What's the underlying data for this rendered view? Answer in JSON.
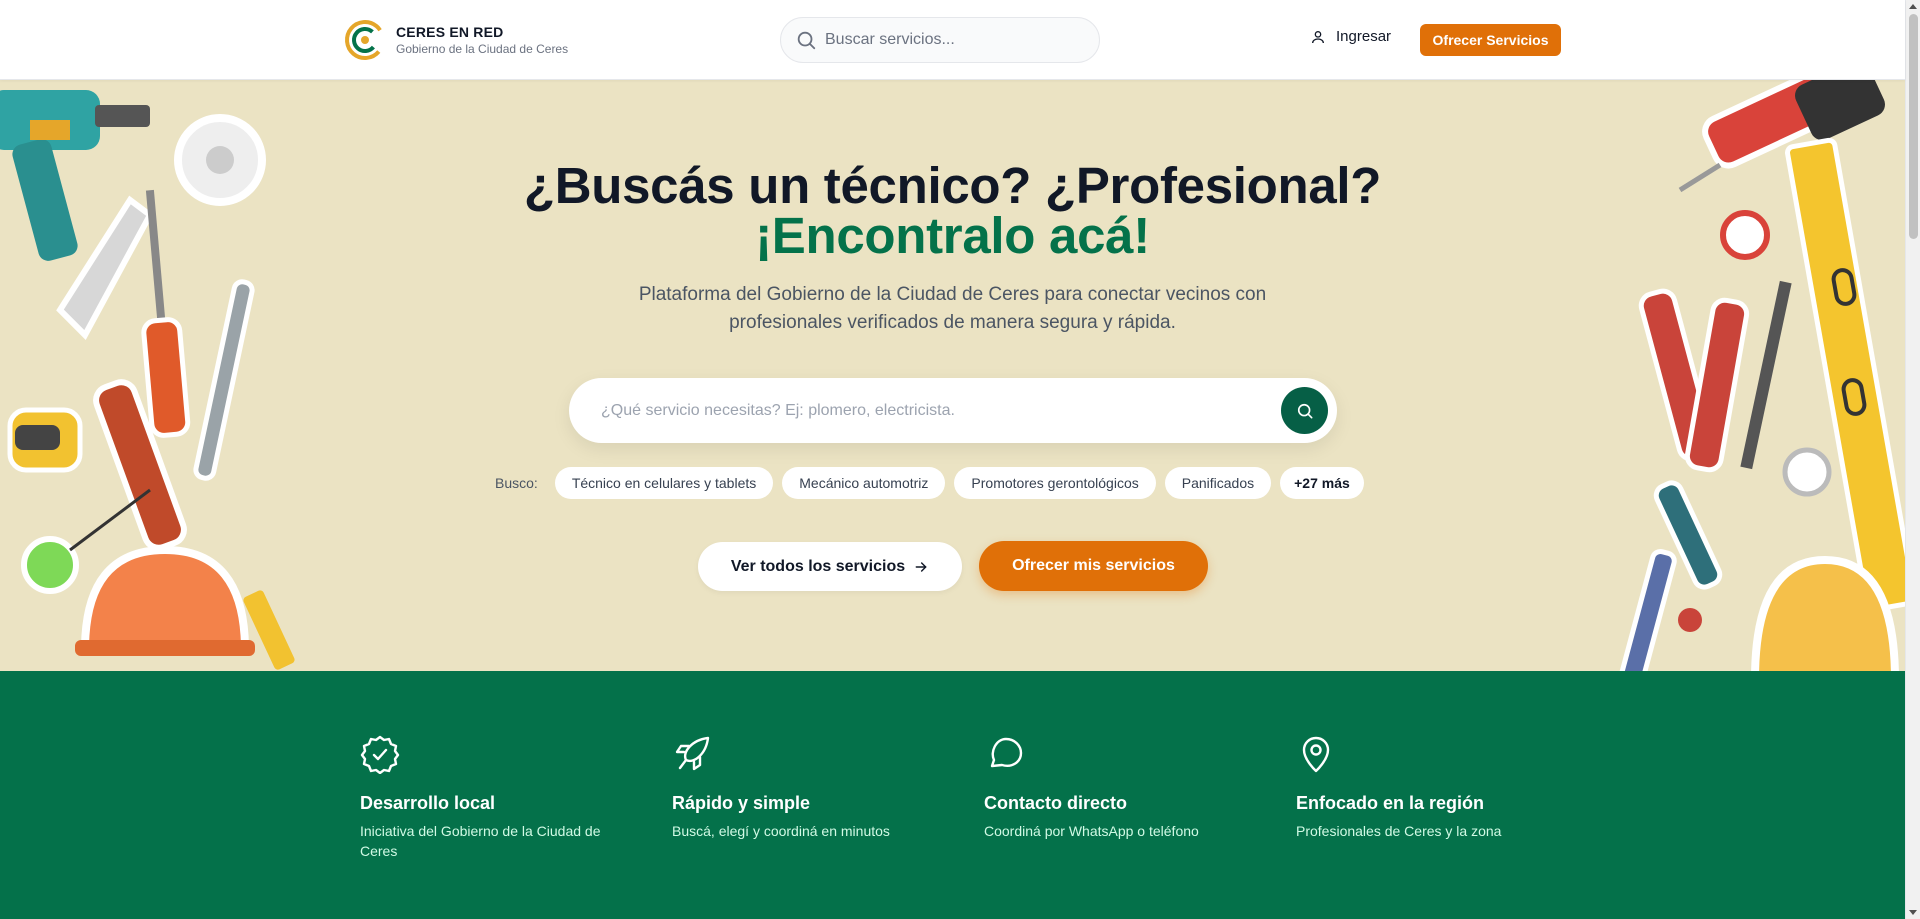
{
  "header": {
    "brand_name": "CERES EN RED",
    "brand_subtitle": "Gobierno de la Ciudad de Ceres",
    "search_placeholder": "Buscar servicios...",
    "login_label": "Ingresar",
    "offer_button": "Ofrecer Servicios"
  },
  "hero": {
    "title_line1": "¿Buscás un técnico? ¿Profesional?",
    "title_line2": "¡Encontralo acá!",
    "subtitle": "Plataforma del Gobierno de la Ciudad de Ceres para conectar vecinos con profesionales verificados de manera segura y rápida.",
    "search_placeholder": "¿Qué servicio necesitas? Ej: plomero, electricista.",
    "chips_label": "Busco:",
    "chips": [
      "Técnico en celulares y tablets",
      "Mecánico automotriz",
      "Promotores gerontológicos",
      "Panificados"
    ],
    "more_chip": "+27 más",
    "cta_all": "Ver todos los servicios",
    "cta_offer": "Ofrecer mis servicios"
  },
  "features": [
    {
      "icon": "badge-check-icon",
      "title": "Desarrollo local",
      "description": "Iniciativa del Gobierno de la Ciudad de Ceres"
    },
    {
      "icon": "rocket-icon",
      "title": "Rápido y simple",
      "description": "Buscá, elegí y coordiná en minutos"
    },
    {
      "icon": "message-circle-icon",
      "title": "Contacto directo",
      "description": "Coordiná por WhatsApp o teléfono"
    },
    {
      "icon": "map-pin-icon",
      "title": "Enfocado en la región",
      "description": "Profesionales de Ceres y la zona"
    }
  ],
  "colors": {
    "accent_orange": "#e07008",
    "brand_green": "#04724a",
    "hero_background": "#ebe3c3",
    "features_background": "#04714a",
    "search_button": "#065f46"
  }
}
